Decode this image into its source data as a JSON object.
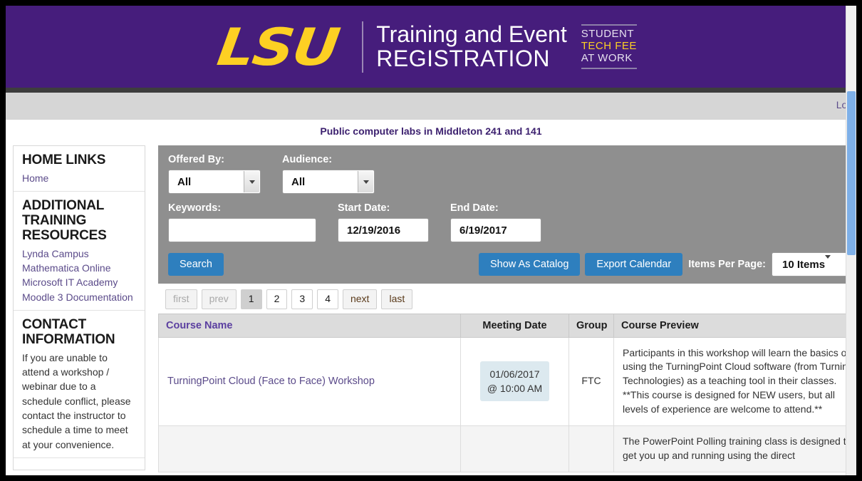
{
  "header": {
    "logo_text": "LSU",
    "title_line1": "Training and Event",
    "title_line2": "REGISTRATION",
    "badge_line1": "STUDENT",
    "badge_line2": "TECH FEE",
    "badge_line3": "AT WORK",
    "colors": {
      "purple": "#461d7c",
      "gold": "#fdd023"
    }
  },
  "topbar": {
    "login_label": "Login"
  },
  "announcement": {
    "text": "Public computer labs in Middleton 241 and 141"
  },
  "sidebar": {
    "sections": [
      {
        "heading": "HOME LINKS",
        "links": [
          "Home"
        ],
        "paragraph": null
      },
      {
        "heading": "ADDITIONAL TRAINING RESOURCES",
        "links": [
          "Lynda Campus",
          "Mathematica Online",
          "Microsoft IT Academy",
          "Moodle 3 Documentation"
        ],
        "paragraph": null
      },
      {
        "heading": "CONTACT INFORMATION",
        "links": [],
        "paragraph": "If you are unable to attend a workshop / webinar due to a schedule conflict, please contact the instructor to schedule a time to meet at your convenience."
      }
    ]
  },
  "search": {
    "offered_by_label": "Offered By:",
    "offered_by_value": "All",
    "audience_label": "Audience:",
    "audience_value": "All",
    "keywords_label": "Keywords:",
    "keywords_value": "",
    "keywords_placeholder": "",
    "start_date_label": "Start Date:",
    "start_date_value": "12/19/2016",
    "end_date_label": "End Date:",
    "end_date_value": "6/19/2017",
    "search_button": "Search",
    "show_as_catalog_button": "Show As Catalog",
    "export_calendar_button": "Export Calendar",
    "items_per_page_label": "Items Per Page:",
    "items_per_page_value": "10 Items",
    "panel_color": "#8f8f8f",
    "button_color": "#2e7fbe"
  },
  "pagination": {
    "first": "first",
    "prev": "prev",
    "pages": [
      "1",
      "2",
      "3",
      "4"
    ],
    "active_page": "1",
    "next": "next",
    "last": "last"
  },
  "table": {
    "columns": [
      "Course Name",
      "Meeting Date",
      "Group",
      "Course Preview"
    ],
    "rows": [
      {
        "course_name": "TurningPoint Cloud (Face to Face) Workshop",
        "meeting_date_line1": "01/06/2017",
        "meeting_date_line2": "@ 10:00 AM",
        "group": "FTC",
        "preview": "Participants in this workshop will learn the basics of using the TurningPoint Cloud software (from Turning Technologies) as a teaching tool in their classes. **This course is designed for NEW users, but all levels of experience are welcome to attend.**"
      },
      {
        "course_name": "",
        "meeting_date_line1": "",
        "meeting_date_line2": "",
        "group": "",
        "preview": "The PowerPoint Polling training class is designed to get you up and running using the direct"
      }
    ]
  }
}
